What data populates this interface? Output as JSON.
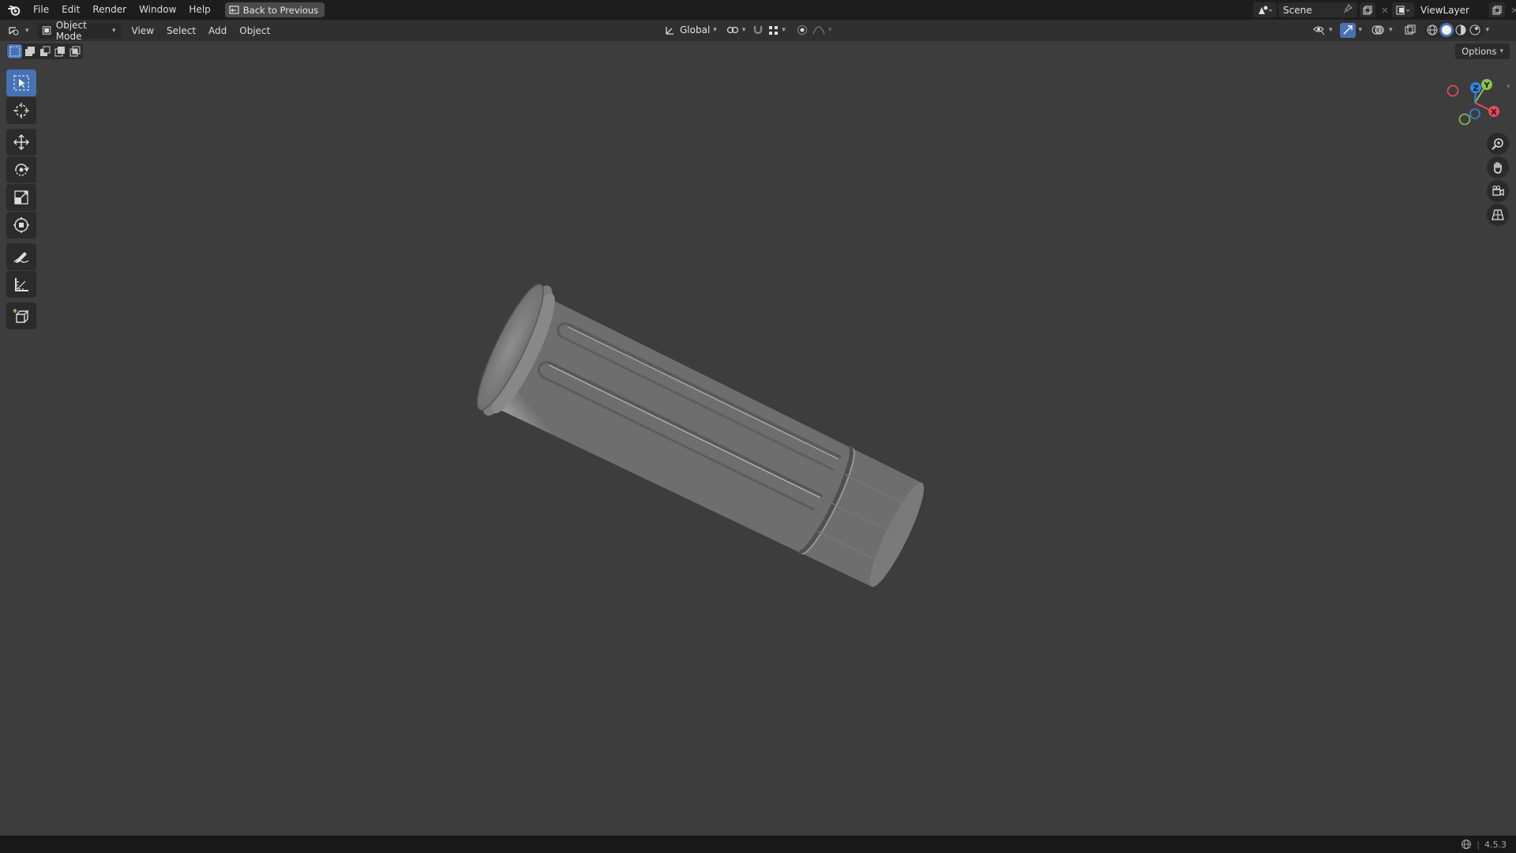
{
  "menubar": {
    "items": [
      "File",
      "Edit",
      "Render",
      "Window",
      "Help"
    ],
    "back_label": "Back to Previous"
  },
  "scene": {
    "name": "Scene"
  },
  "view_layer": {
    "name": "ViewLayer"
  },
  "header": {
    "mode": "Object Mode",
    "menus": [
      "View",
      "Select",
      "Add",
      "Object"
    ],
    "orientation": "Global"
  },
  "viewport": {
    "options_label": "Options",
    "gizmo": {
      "x_label": "X",
      "y_label": "Y",
      "z_label": "Z"
    }
  },
  "tools": [
    "select-box",
    "cursor",
    "move",
    "rotate",
    "scale",
    "transform",
    "annotate",
    "measure",
    "add-cube"
  ],
  "status": {
    "version": "4.5.3"
  },
  "colors": {
    "accent": "#4772b3",
    "x_axis": "#e94a5a",
    "y_axis": "#8bc34a",
    "z_axis": "#2f85e3"
  }
}
